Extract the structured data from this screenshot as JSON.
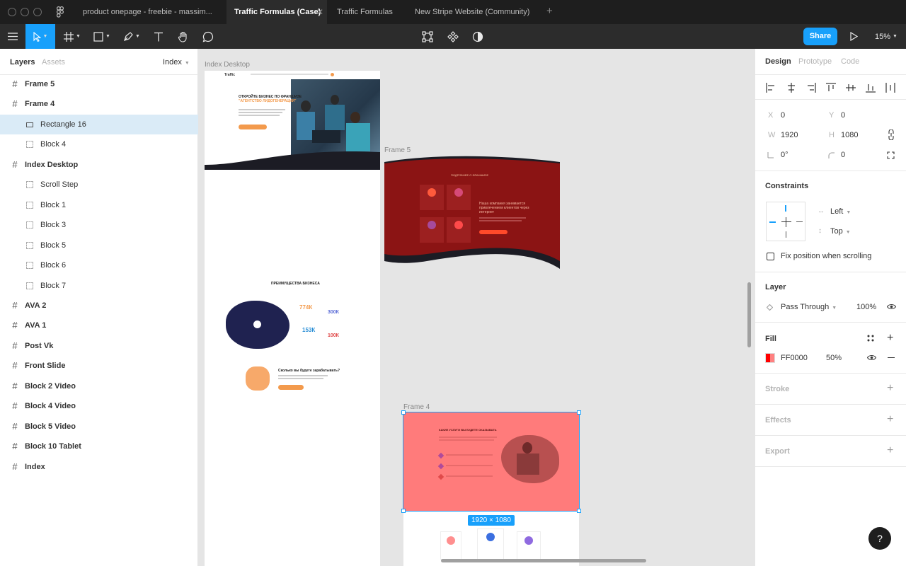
{
  "tabs": [
    {
      "label": "product onepage - freebie - massim..."
    },
    {
      "label": "Traffic Formulas (Case)"
    },
    {
      "label": "Traffic Formulas"
    },
    {
      "label": "New Stripe Website (Community)"
    }
  ],
  "toolbar": {
    "share_label": "Share",
    "zoom": "15%",
    "tools": [
      "menu-icon",
      "move-icon",
      "frame-icon",
      "rectangle-icon",
      "pen-icon",
      "text-icon",
      "hand-icon",
      "comment-icon"
    ]
  },
  "left_panel": {
    "tab_layers": "Layers",
    "tab_assets": "Assets",
    "page_selector": "Index",
    "layers": [
      {
        "label": "Frame 5",
        "kind": "frame",
        "indent": 0
      },
      {
        "label": "Frame 4",
        "kind": "frame",
        "indent": 0
      },
      {
        "label": "Rectangle 16",
        "kind": "rectangle",
        "indent": 1
      },
      {
        "label": "Block 4",
        "kind": "group",
        "indent": 1
      },
      {
        "label": "Index Desktop",
        "kind": "frame",
        "indent": 0
      },
      {
        "label": "Scroll Step",
        "kind": "group",
        "indent": 1
      },
      {
        "label": "Block 1",
        "kind": "group",
        "indent": 1
      },
      {
        "label": "Block 3",
        "kind": "group",
        "indent": 1
      },
      {
        "label": "Block 5",
        "kind": "group",
        "indent": 1
      },
      {
        "label": "Block 6",
        "kind": "group",
        "indent": 1
      },
      {
        "label": "Block 7",
        "kind": "group",
        "indent": 1
      },
      {
        "label": "AVA 2",
        "kind": "frame",
        "indent": 0
      },
      {
        "label": "AVA 1",
        "kind": "frame",
        "indent": 0
      },
      {
        "label": "Post Vk",
        "kind": "frame",
        "indent": 0
      },
      {
        "label": " Front Slide",
        "kind": "frame",
        "indent": 0
      },
      {
        "label": "Block 2 Video",
        "kind": "frame",
        "indent": 0
      },
      {
        "label": "Block 4 Video",
        "kind": "frame",
        "indent": 0
      },
      {
        "label": "Block 5 Video",
        "kind": "frame",
        "indent": 0
      },
      {
        "label": "Block 10 Tablet",
        "kind": "frame",
        "indent": 0
      },
      {
        "label": "Index",
        "kind": "frame",
        "indent": 0
      }
    ]
  },
  "canvas": {
    "frame_index_desktop": "Index Desktop",
    "frame_5": "Frame 5",
    "frame_4": "Frame 4",
    "selection_size": "1920 × 1080",
    "hero_heading": "ОТКРОЙТЕ БИЗНЕС ПО ФРАНШИЗЕ",
    "hero_sub": "\"АГЕНТСТВО ЛИДОГЕНЕРАЦИИ\"",
    "frame5_title": "ПОДРОБНЕЕ О ФРАНШИЗЕ",
    "frame5_text": "Наша компания занимается привлечением клиентов через интернет",
    "benefits_title": "ПРЕИМУЩЕСТВА БИЗНЕСА",
    "stat_1": "774К",
    "stat_2": "300К",
    "stat_3": "153К",
    "stat_4": "100К",
    "earn_title": "Сколько вы будете зарабатывать?",
    "frame4_title": "КАКИЕ УСЛУГИ ВЫ БУДЕТЕ ОКАЗЫВАТЬ",
    "red_accent": "#8b1414",
    "pink_fill": "#ff7b7b"
  },
  "right_panel": {
    "tab_design": "Design",
    "tab_prototype": "Prototype",
    "tab_code": "Code",
    "x_label": "X",
    "x_value": "0",
    "y_label": "Y",
    "y_value": "0",
    "w_label": "W",
    "w_value": "1920",
    "h_label": "H",
    "h_value": "1080",
    "rotation_value": "0°",
    "radius_value": "0",
    "constraints_title": "Constraints",
    "constraint_h": "Left",
    "constraint_v": "Top",
    "fix_scroll_label": "Fix position when scrolling",
    "layer_title": "Layer",
    "blend_mode": "Pass Through",
    "layer_opacity": "100%",
    "fill_title": "Fill",
    "fill_hex": "FF0000",
    "fill_opacity": "50%",
    "fill_color": "#ff0000",
    "stroke_title": "Stroke",
    "effects_title": "Effects",
    "export_title": "Export"
  },
  "help_label": "?"
}
